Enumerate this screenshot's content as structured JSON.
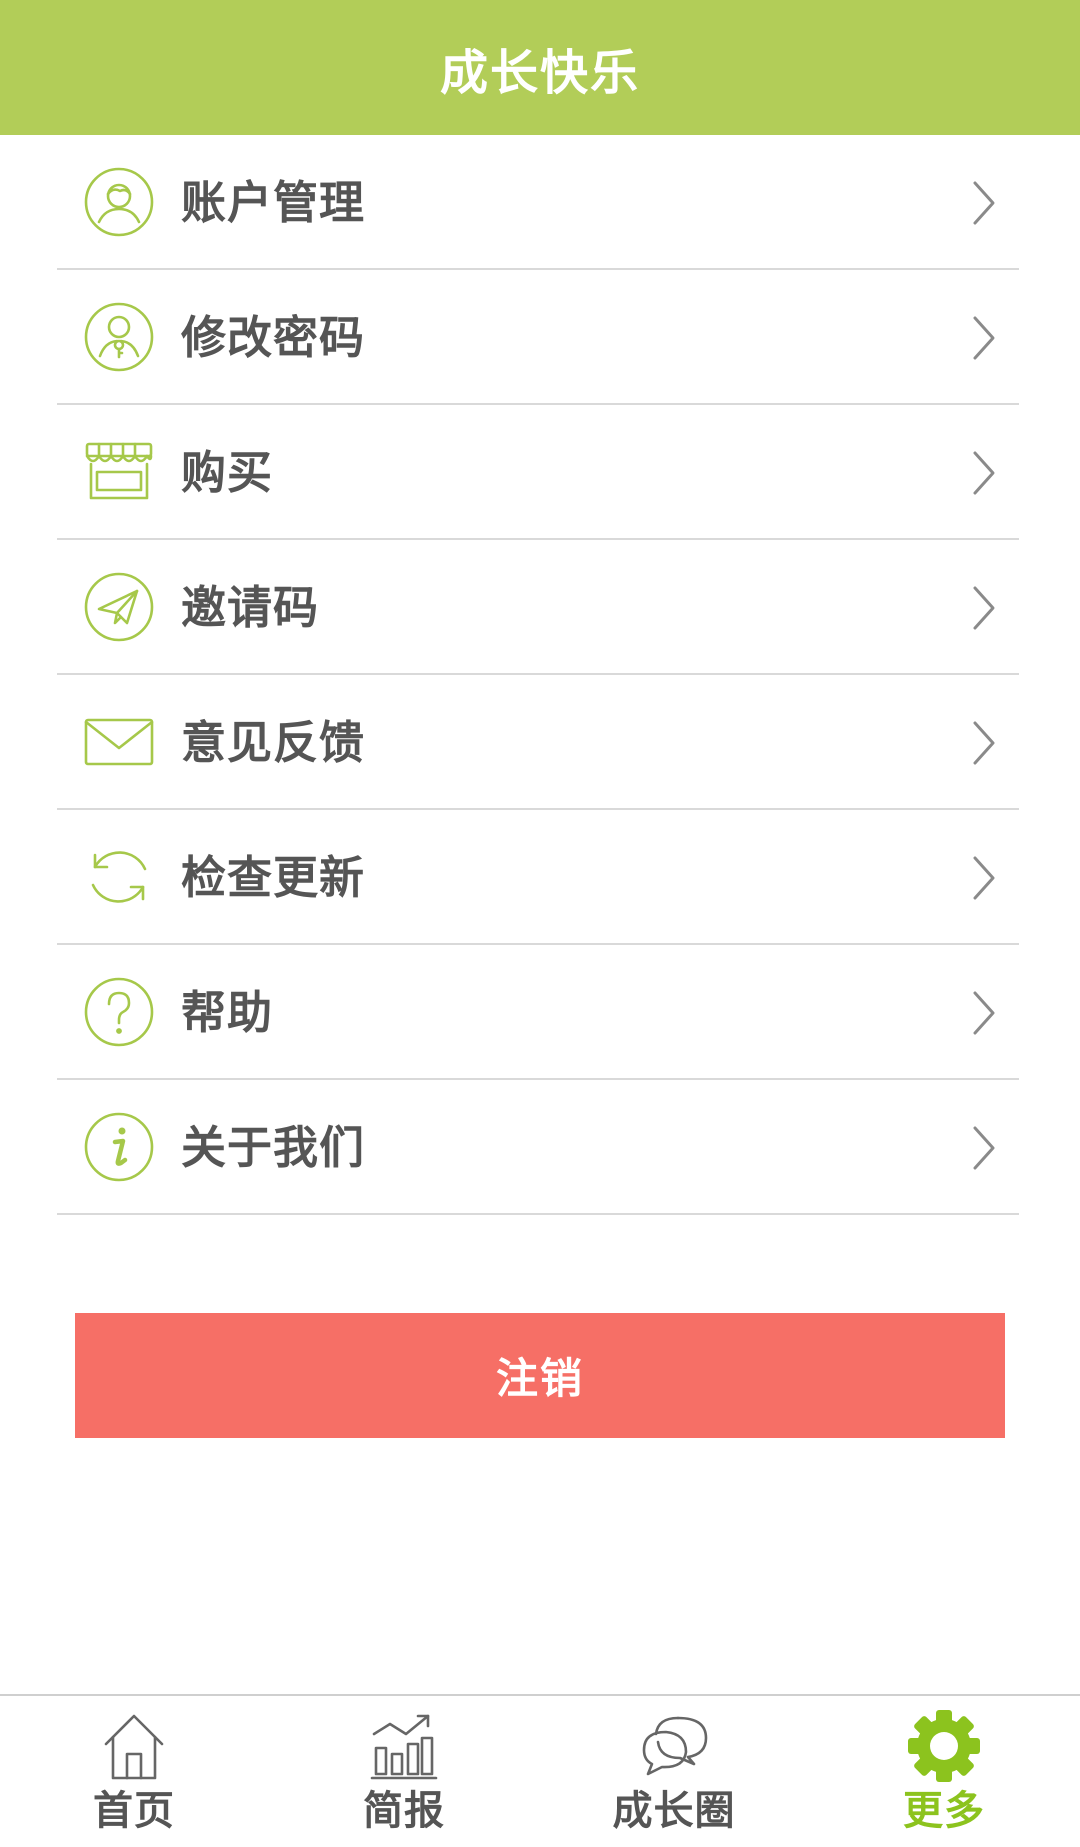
{
  "header": {
    "title": "成长快乐"
  },
  "menu": {
    "items": [
      {
        "label": "账户管理",
        "icon": "user-icon"
      },
      {
        "label": "修改密码",
        "icon": "key-user-icon"
      },
      {
        "label": "购买",
        "icon": "shop-icon"
      },
      {
        "label": "邀请码",
        "icon": "paper-plane-icon"
      },
      {
        "label": "意见反馈",
        "icon": "envelope-icon"
      },
      {
        "label": "检查更新",
        "icon": "refresh-icon"
      },
      {
        "label": "帮助",
        "icon": "question-icon"
      },
      {
        "label": "关于我们",
        "icon": "info-icon"
      }
    ]
  },
  "logout": {
    "label": "注销"
  },
  "tabbar": {
    "tabs": [
      {
        "label": "首页",
        "icon": "home-icon",
        "active": false
      },
      {
        "label": "简报",
        "icon": "chart-icon",
        "active": false
      },
      {
        "label": "成长圈",
        "icon": "chat-icon",
        "active": false
      },
      {
        "label": "更多",
        "icon": "gear-icon",
        "active": true
      }
    ]
  },
  "colors": {
    "brand_green": "#b2cd58",
    "icon_green": "#a6c84a",
    "active_green": "#8cc31e",
    "logout_red": "#f66f66",
    "text_gray": "#555555",
    "divider": "#d9d9d9"
  }
}
